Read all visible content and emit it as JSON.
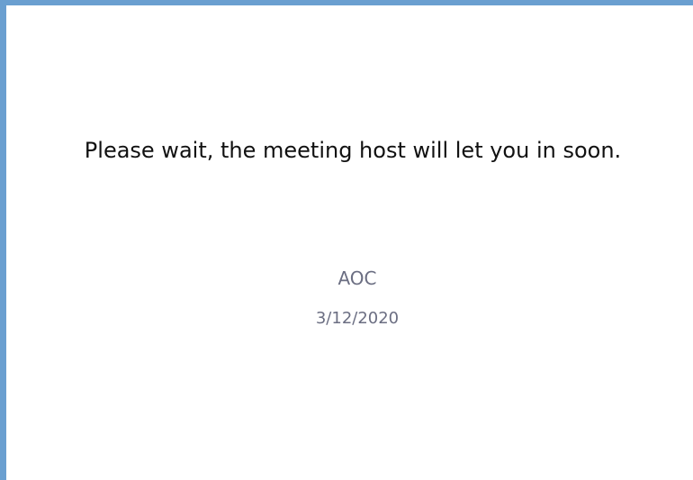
{
  "waiting_room": {
    "message": "Please wait, the meeting host will let you in soon.",
    "meeting_name": "AOC",
    "meeting_date": "3/12/2020"
  },
  "colors": {
    "window_border": "#6a9fd0",
    "message_text": "#111111",
    "secondary_text": "#6b6e82",
    "background": "#ffffff"
  }
}
